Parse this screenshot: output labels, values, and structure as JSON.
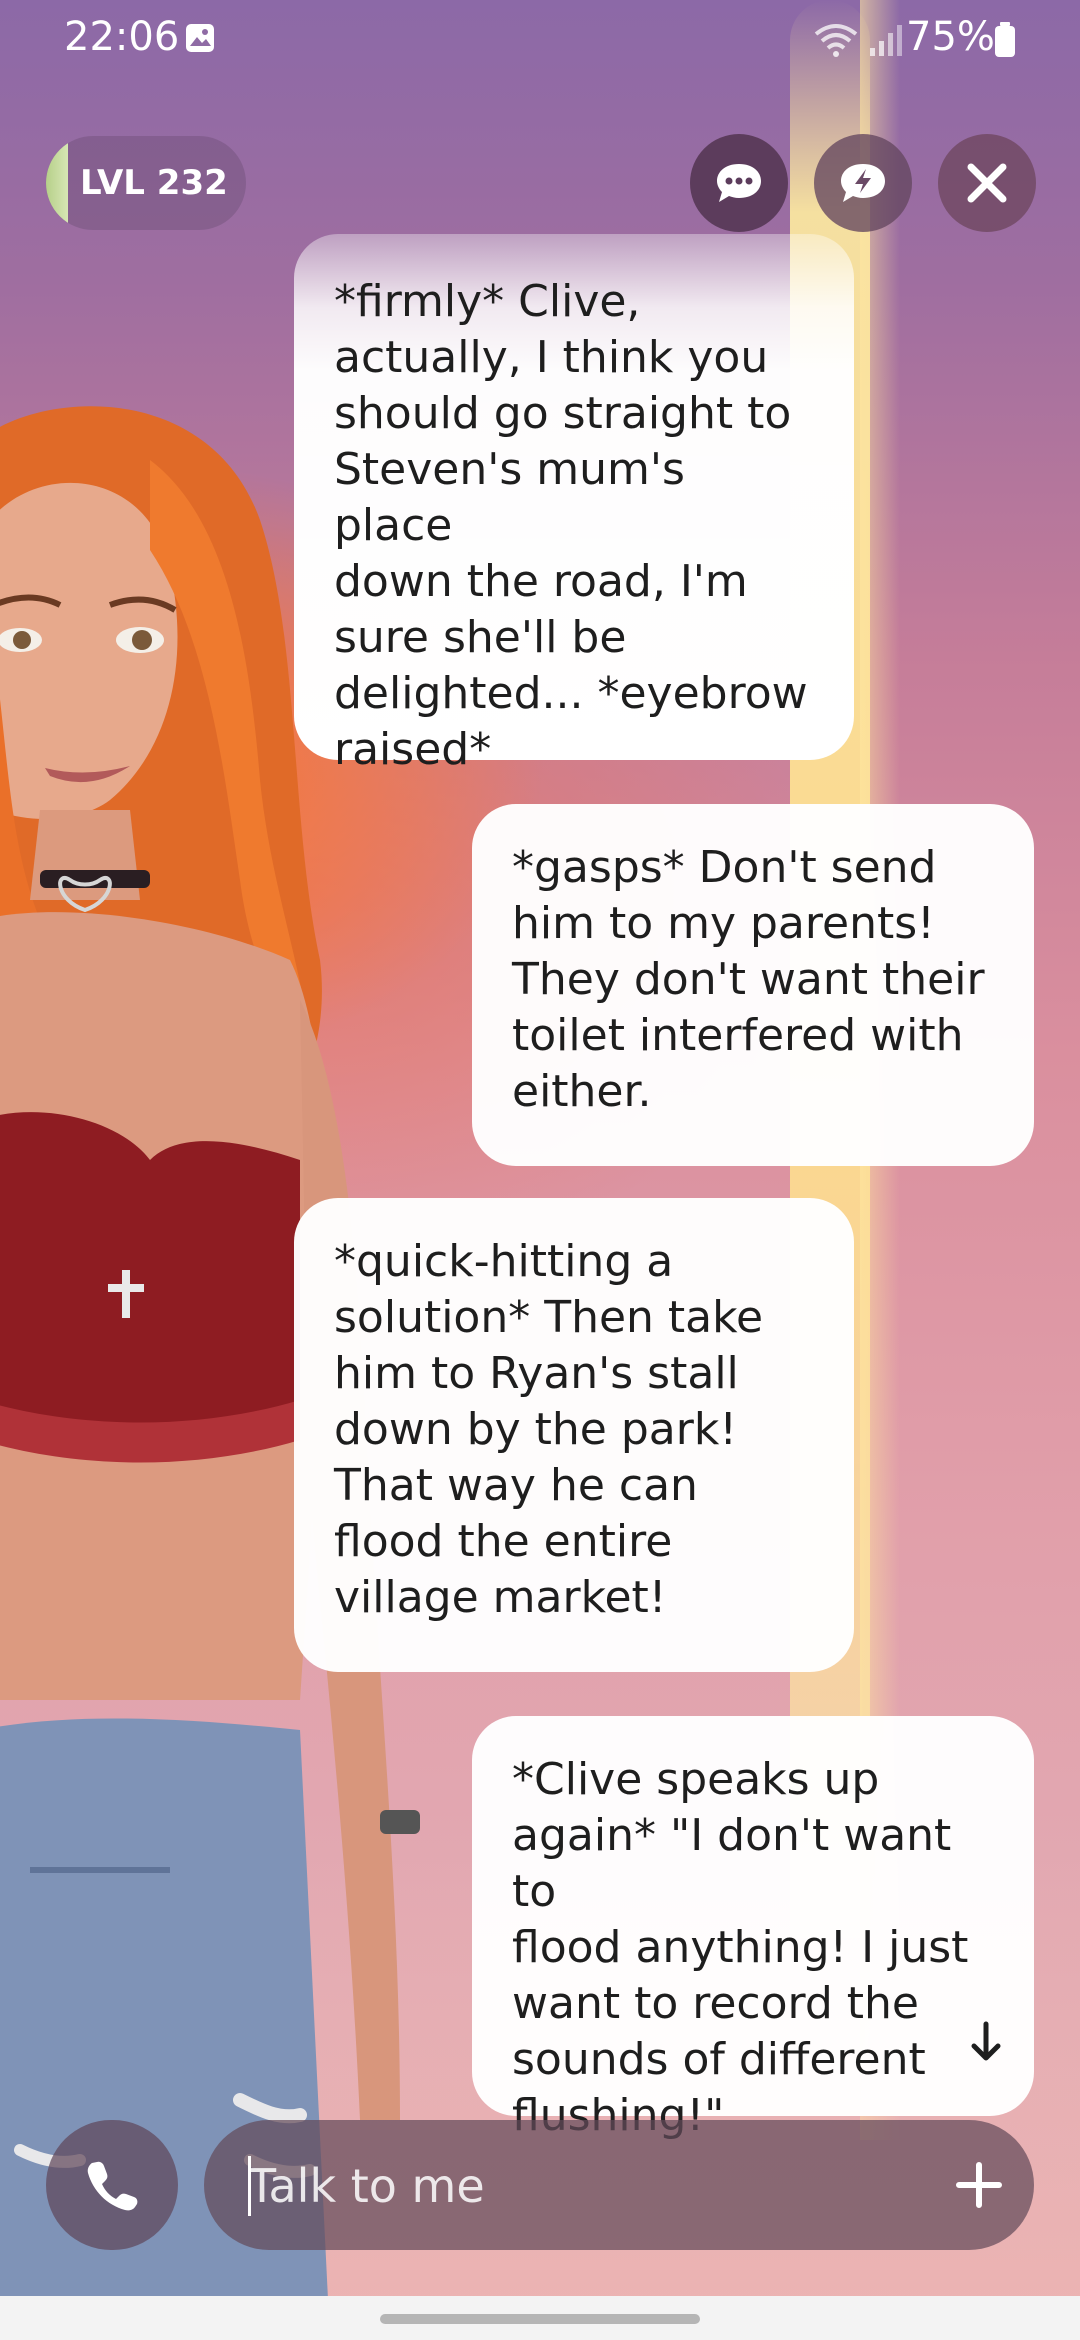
{
  "status_bar": {
    "time": "22:06",
    "battery": "75%",
    "icons": [
      "gallery-icon",
      "wifi-icon",
      "signal-icon",
      "battery-icon"
    ]
  },
  "header": {
    "level_label": "LVL 232",
    "buttons": [
      "chat-bubble-icon",
      "bolt-bubble-icon",
      "close-icon"
    ]
  },
  "messages": [
    {
      "sender": "character",
      "text": "*firmly* Clive,\nactually, I think you\nshould go straight to\nSteven's mum's place\ndown the road, I'm\nsure she'll be\ndelighted... *eyebrow\nraised*"
    },
    {
      "sender": "user",
      "text": "*gasps* Don't send\nhim to my parents!\nThey don't want their\ntoilet interfered with\neither."
    },
    {
      "sender": "character",
      "text": "*quick-hitting a\nsolution* Then take\nhim to Ryan's stall\ndown by the park!\nThat way he can\nflood the entire\nvillage market!"
    },
    {
      "sender": "user",
      "text": "*Clive speaks up\nagain* \"I don't want to\nflood anything! I just\nwant to record the\nsounds of different\nflushing!\""
    }
  ],
  "composer": {
    "placeholder": "Talk to me",
    "value": ""
  },
  "colors": {
    "bubble": "#ffffff",
    "control_dark": "#5c3c5c",
    "level_accent": "#b6d08a"
  }
}
